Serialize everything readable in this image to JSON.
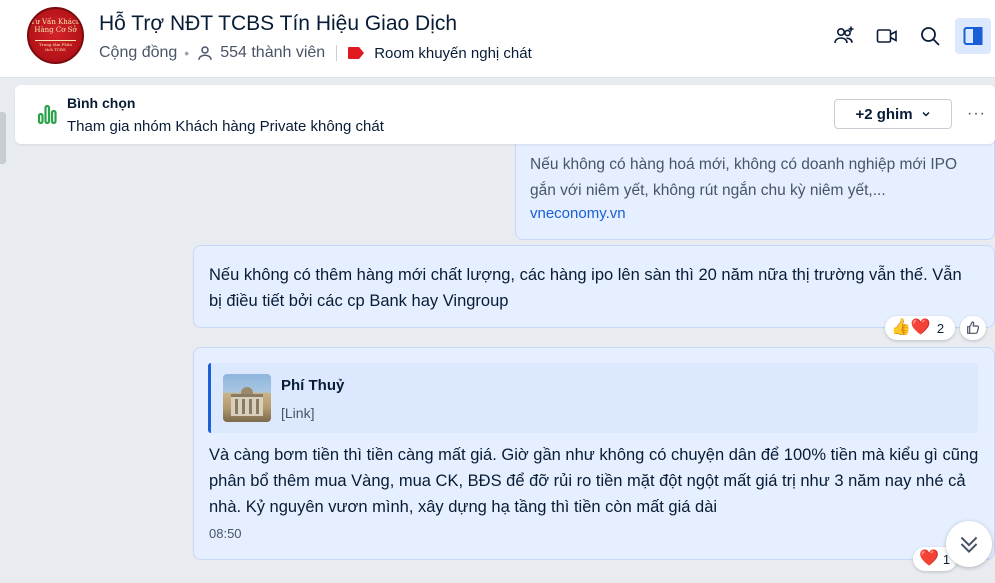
{
  "header": {
    "avatar_text": [
      "Tư Vấn Khách",
      "Hàng Cơ Sở",
      "Trung tâm Phân tích TCBS"
    ],
    "title": "Hỗ Trợ NĐT TCBS Tín Hiệu Giao Dịch",
    "category": "Cộng đồng",
    "member_count": "554 thành viên",
    "room_label": "Room khuyến nghị chát",
    "icons": [
      "add-member-icon",
      "video-call-icon",
      "search-icon",
      "sidebar-toggle-icon"
    ],
    "colors": {
      "accent": "#1a5fd6",
      "room_tag": "#e0181f",
      "active_btn_bg": "#dbe8fe"
    }
  },
  "pinned": {
    "title": "Bình chọn",
    "subtitle": "Tham gia nhóm Khách hàng Private không chát",
    "pin_count_label": "+2 ghim",
    "more_label": "···"
  },
  "messages": [
    {
      "link_description": "Nếu không có hàng hoá mới, không có doanh nghiệp mới IPO gắn với niêm yết, không rút ngắn chu kỳ niêm yết,...",
      "link_domain": "vneconomy.vn"
    },
    {
      "text": "Nếu không có thêm hàng mới chất lượng, các hàng ipo lên sàn thì 20 năm nữa thị trường vẫn thế. Vẫn bị điều tiết bởi các cp Bank hay Vingroup",
      "reactions": {
        "emojis": "👍❤️",
        "count": "2"
      }
    },
    {
      "quote_author": "Phí Thuỷ",
      "quote_content": "[Link]",
      "text": "Và càng bơm tiền thì tiền càng mất giá. Giờ gần như không có chuyện dân để 100% tiền mà kiểu gì cũng phân bổ thêm mua Vàng, mua CK, BĐS để đỡ rủi ro tiền mặt đột ngột mất giá trị như 3 năm nay nhé cả nhà. Kỷ nguyên vươn mình, xây dựng hạ tầng thì tiền còn mất giá dài",
      "time": "08:50",
      "reactions": {
        "emojis": "❤️",
        "count": "1"
      }
    }
  ]
}
